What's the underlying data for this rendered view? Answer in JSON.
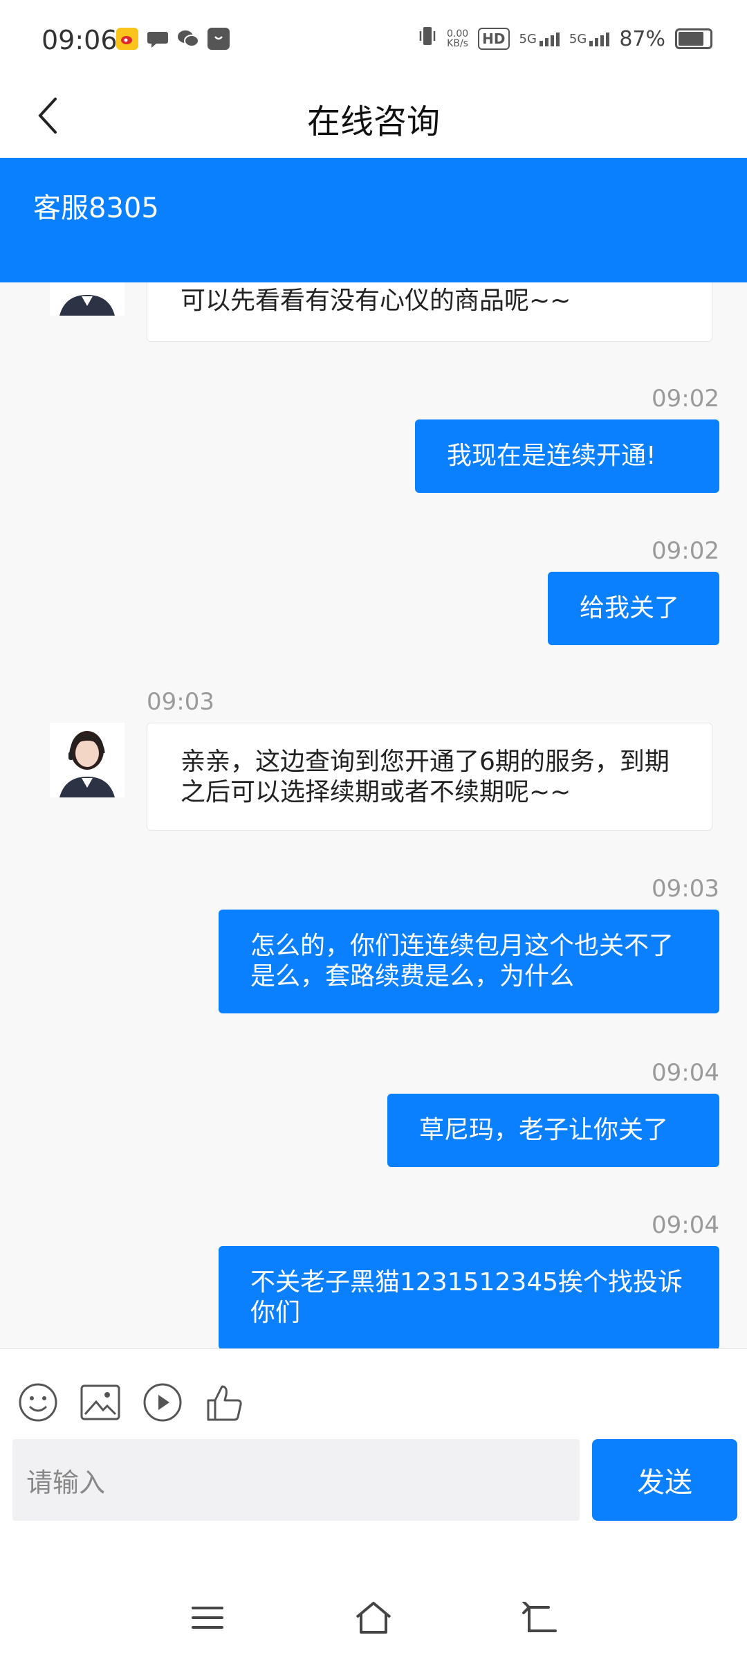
{
  "status_bar": {
    "time": "09:06",
    "net_speed_value": "0.00",
    "net_speed_unit": "KB/s",
    "hd_label": "HD",
    "sim1": "5G",
    "sim2": "5G",
    "battery": "87%"
  },
  "nav": {
    "title": "在线咨询"
  },
  "agent": {
    "name": "客服8305"
  },
  "messages": [
    {
      "side": "in",
      "time": "",
      "text": "可以先看看有没有心仪的商品呢~~"
    },
    {
      "side": "out",
      "time": "09:02",
      "text": "我现在是连续开通!"
    },
    {
      "side": "out",
      "time": "09:02",
      "text": "给我关了"
    },
    {
      "side": "in",
      "time": "09:03",
      "text": "亲亲，这边查询到您开通了6期的服务，到期之后可以选择续期或者不续期呢~~"
    },
    {
      "side": "out",
      "time": "09:03",
      "text": "怎么的，你们连连续包月这个也关不了是么，套路续费是么，为什么"
    },
    {
      "side": "out",
      "time": "09:04",
      "text": "草尼玛，老子让你关了"
    },
    {
      "side": "out",
      "time": "09:04",
      "text": "不关老子黑猫1231512345挨个找投诉你们"
    }
  ],
  "composer": {
    "placeholder": "请输入",
    "send_label": "发送",
    "tools": [
      "emoji-icon",
      "image-icon",
      "video-icon",
      "thumbs-up-icon"
    ]
  },
  "colors": {
    "accent": "#0a80ff"
  }
}
